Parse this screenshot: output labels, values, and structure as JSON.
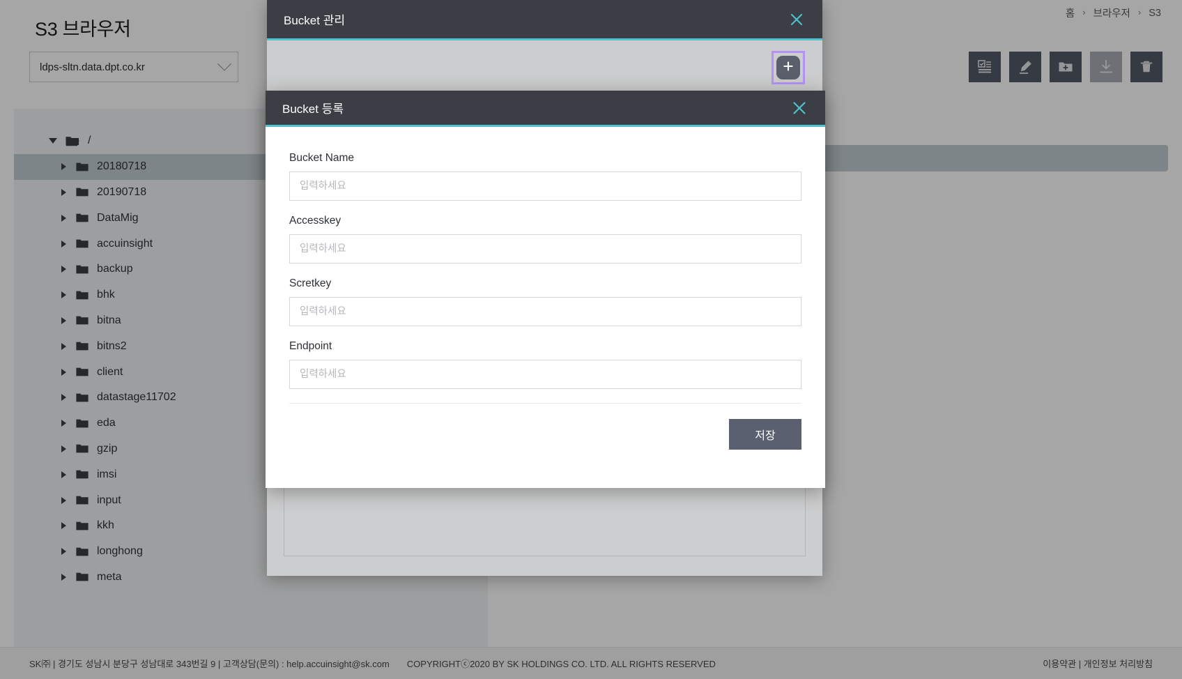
{
  "page": {
    "title": "S3 브라우저",
    "host_select": {
      "value": "ldps-sltn.data.dpt.co.kr",
      "chevron_icon": "chevron-down-icon"
    },
    "breadcrumb": {
      "items": [
        "홈",
        "브라우저",
        "S3"
      ],
      "separator": "›"
    },
    "toolbar": [
      {
        "name": "checklist-button",
        "icon": "checklist-icon",
        "disabled": false
      },
      {
        "name": "edit-button",
        "icon": "pencil-icon",
        "disabled": false
      },
      {
        "name": "new-folder-button",
        "icon": "folder-plus-icon",
        "disabled": false
      },
      {
        "name": "download-button",
        "icon": "download-icon",
        "disabled": true
      },
      {
        "name": "delete-button",
        "icon": "trash-icon",
        "disabled": false
      }
    ]
  },
  "tree": {
    "root": {
      "label": "/",
      "icon": "folder-open-icon",
      "caret": "caret-down-icon"
    },
    "items": [
      {
        "label": "20180718",
        "selected": true
      },
      {
        "label": "20190718",
        "selected": false
      },
      {
        "label": "DataMig",
        "selected": false
      },
      {
        "label": "accuinsight",
        "selected": false
      },
      {
        "label": "backup",
        "selected": false
      },
      {
        "label": "bhk",
        "selected": false
      },
      {
        "label": "bitna",
        "selected": false
      },
      {
        "label": "bitns2",
        "selected": false
      },
      {
        "label": "client",
        "selected": false
      },
      {
        "label": "datastage11702",
        "selected": false
      },
      {
        "label": "eda",
        "selected": false
      },
      {
        "label": "gzip",
        "selected": false
      },
      {
        "label": "imsi",
        "selected": false
      },
      {
        "label": "input",
        "selected": false
      },
      {
        "label": "kkh",
        "selected": false
      },
      {
        "label": "longhong",
        "selected": false
      },
      {
        "label": "meta",
        "selected": false
      }
    ]
  },
  "modal_manage": {
    "title": "Bucket 관리",
    "close_icon": "close-icon",
    "add_button_icon": "plus-icon",
    "add_button_name": "add-bucket-button"
  },
  "modal_register": {
    "title": "Bucket 등록",
    "close_icon": "close-icon",
    "fields": [
      {
        "label": "Bucket Name",
        "value": "",
        "placeholder": "입력하세요",
        "name": "bucket-name-input"
      },
      {
        "label": "Accesskey",
        "value": "",
        "placeholder": "입력하세요",
        "name": "accesskey-input"
      },
      {
        "label": "Scretkey",
        "value": "",
        "placeholder": "입력하세요",
        "name": "secretkey-input"
      },
      {
        "label": "Endpoint",
        "value": "",
        "placeholder": "입력하세요",
        "name": "endpoint-input"
      }
    ],
    "save_label": "저장"
  },
  "footer": {
    "left": "SK㈜ | 경기도 성남시 분당구 성남대로 343번길 9 | 고객상담(문의) : help.accuinsight@sk.com",
    "copyright": "COPYRIGHTⓒ2020 BY SK HOLDINGS CO. LTD. ALL RIGHTS RESERVED",
    "right": "이용약관 | 개인정보 처리방침"
  },
  "colors": {
    "accent_teal": "#4ec3d0",
    "modal_header": "#3b3e44",
    "focus_ring": "#b492f5",
    "button_slate": "#5a6070",
    "selected_row": "#c2ccd2"
  }
}
